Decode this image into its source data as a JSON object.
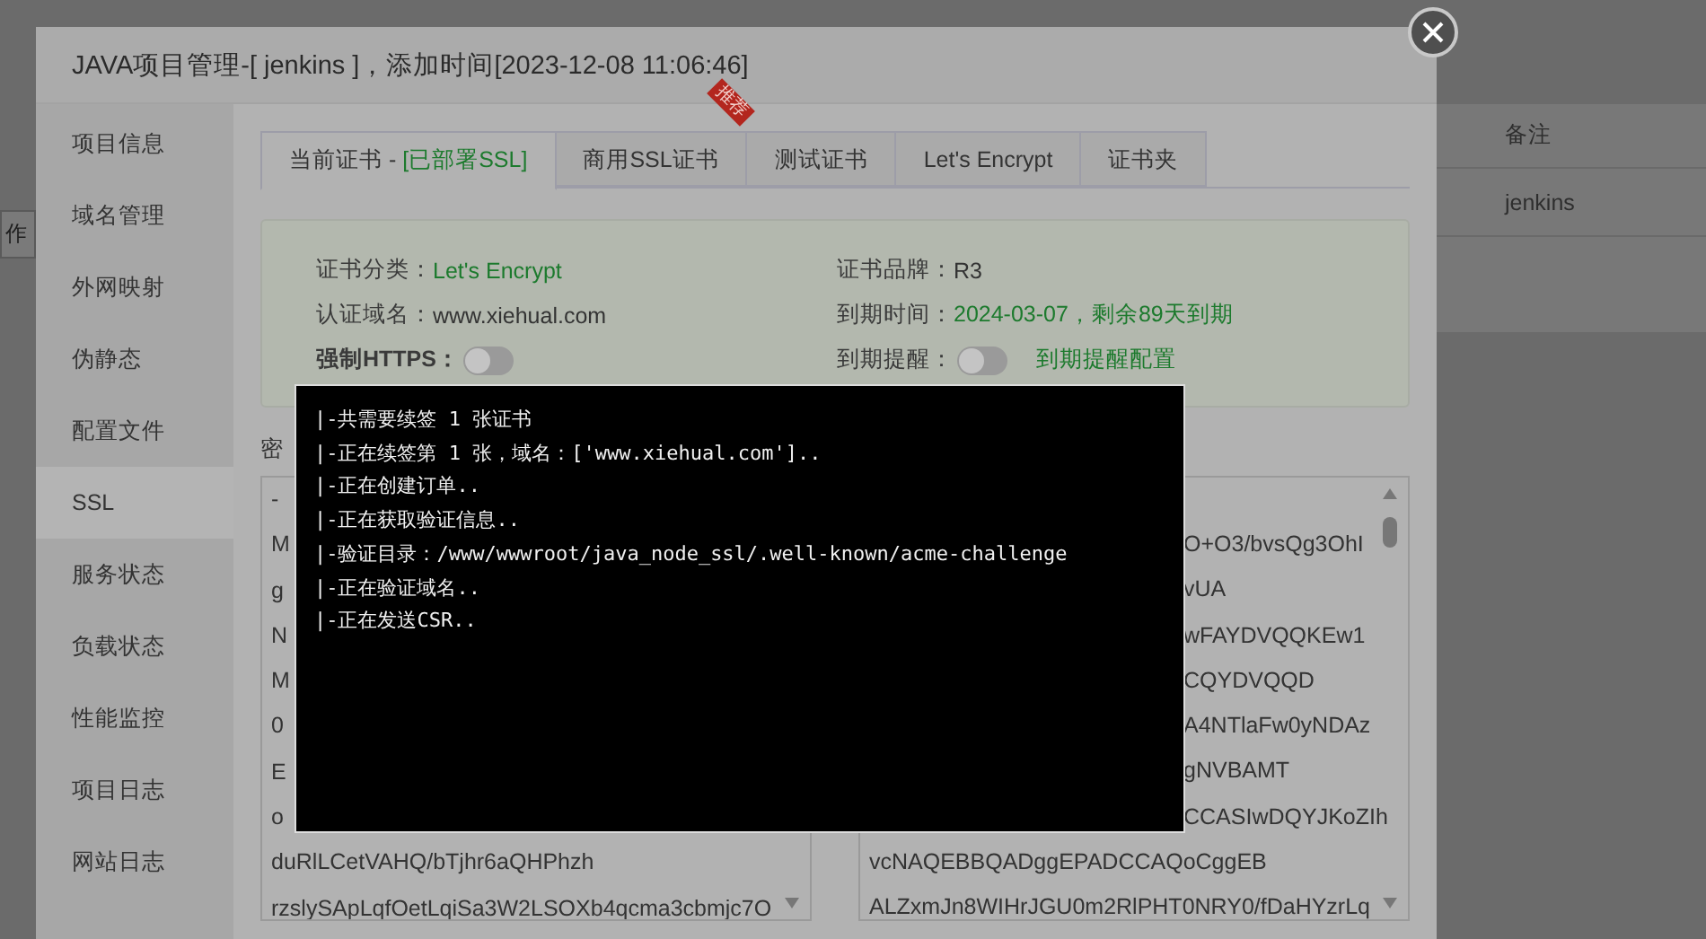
{
  "background": {
    "side_button": "作",
    "table_header": "备注",
    "table_cell": "jenkins"
  },
  "window": {
    "title": "JAVA项目管理-[ jenkins ]，添加时间[2023-12-08 11:06:46]"
  },
  "sidebar": {
    "items": [
      {
        "label": "项目信息",
        "selected": false
      },
      {
        "label": "域名管理",
        "selected": false
      },
      {
        "label": "外网映射",
        "selected": false
      },
      {
        "label": "伪静态",
        "selected": false
      },
      {
        "label": "配置文件",
        "selected": false
      },
      {
        "label": "SSL",
        "selected": true
      },
      {
        "label": "服务状态",
        "selected": false
      },
      {
        "label": "负载状态",
        "selected": false
      },
      {
        "label": "性能监控",
        "selected": false
      },
      {
        "label": "项目日志",
        "selected": false
      },
      {
        "label": "网站日志",
        "selected": false
      }
    ]
  },
  "tabs": [
    {
      "label": "当前证书 - ",
      "status": "[已部署SSL]",
      "selected": true
    },
    {
      "label": "商用SSL证书",
      "badge": "推荐",
      "selected": false
    },
    {
      "label": "测试证书",
      "selected": false
    },
    {
      "label": "Let's Encrypt",
      "selected": false
    },
    {
      "label": "证书夹",
      "selected": false
    }
  ],
  "cert_info": {
    "category": {
      "label": "证书分类：",
      "value": "Let's Encrypt"
    },
    "brand": {
      "label": "证书品牌：",
      "value": "R3"
    },
    "domain": {
      "label": "认证域名：",
      "value": "www.xiehual.com"
    },
    "expiry": {
      "label": "到期时间：",
      "value": "2024-03-07，剩余89天到期"
    },
    "force_https": {
      "label": "强制HTTPS：",
      "on": false
    },
    "expiry_reminder": {
      "label": "到期提醒：",
      "on": false,
      "link": "到期提醒配置"
    }
  },
  "key_label": "密",
  "key_box": {
    "lines": [
      "-",
      "M",
      "g",
      "N",
      "M",
      "0",
      "E",
      "o",
      "duRlLCetVAHQ/bTjhr6aQHPhzh",
      "rzslySApLqfOetLqiSa3W2LSOXb4qcma3cbmjc7O"
    ]
  },
  "cert_box": {
    "lines": [
      {
        "text": "O+O3/bvsQg3OhI",
        "kind": "partial"
      },
      {
        "text": "vUA",
        "kind": "partial"
      },
      {
        "text": "wFAYDVQQKEw1",
        "kind": "partial"
      },
      {
        "text": "CQYDVQQD",
        "kind": "partial"
      },
      {
        "text": "A4NTlaFw0yNDAz",
        "kind": "partial"
      },
      {
        "text": "gNVBAMT",
        "kind": "partial"
      },
      {
        "text": "CCASIwDQYJKoZIh",
        "kind": "partial"
      },
      {
        "text": "vcNAQEBBQADggEPADCCAQoCggEB",
        "kind": "full"
      },
      {
        "text": "ALZxmJn8WIHrJGU0m2RlPHT0NRY0/fDaHYzrLq",
        "kind": "full"
      }
    ]
  },
  "terminal": {
    "lines": [
      "|-共需要续签 1 张证书",
      "|-正在续签第 1 张，域名：['www.xiehual.com']..",
      "|-正在创建订单..",
      "|-正在获取验证信息..",
      "|-验证目录：/www/wwwroot/java_node_ssl/.well-known/acme-challenge",
      "|-正在验证域名..",
      "|-正在发送CSR.."
    ]
  }
}
